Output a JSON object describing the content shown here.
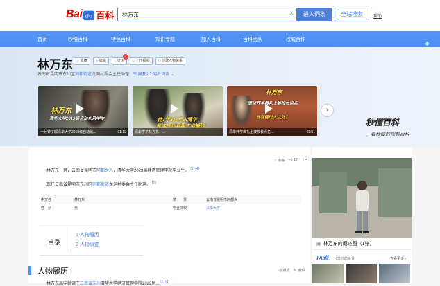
{
  "header": {
    "logo_text_a": "Bai",
    "logo_text_b": "百科",
    "search_value": "林万东",
    "enter_label": "进入词条",
    "all_search_label": "全站搜索",
    "help_label": "帮助"
  },
  "nav": {
    "items": [
      "首页",
      "秒懂百科",
      "特色百科",
      "知识专题",
      "加入百科",
      "百科团队",
      "权威合作"
    ],
    "user_label": "个人中心"
  },
  "entry": {
    "title": "林万东",
    "actions": [
      {
        "icon": "star-icon",
        "label": "收藏"
      },
      {
        "icon": "edit-icon",
        "label": "编辑"
      },
      {
        "icon": "discuss-icon",
        "label": "讨论",
        "badge": "2"
      },
      {
        "icon": "upload-video-icon",
        "label": "上传视频"
      },
      {
        "icon": "relation-icon",
        "label": "创建人物关系"
      }
    ],
    "subtitle_pre": "云南省昆明市东川区",
    "subtitle_link": "铜都街道",
    "subtitle_post": "龙洞村委会主任助理",
    "subtitle_more": "展开2个同名词条"
  },
  "videos": [
    {
      "overlay_a": "林万东",
      "overlay_b": "清华大学2019级自动化系学生",
      "caption": "一分钟了解清华大学2019级自动化...",
      "duration": "01:12"
    },
    {
      "overlay_a": "他7年3分考入清华",
      "overlay_b": "竟选择到县里工地搬砖",
      "caption": "清华学子林万东：...",
      "duration": ""
    },
    {
      "overlay_a": "林万东",
      "overlay_b": "清华开学典礼上被校长点名",
      "overlay_c": "他有何过人之处？",
      "caption": "清华开学典礼上被校长点名...",
      "duration": "03:51"
    }
  ],
  "next_arrow": "›",
  "brand": {
    "line1": "秒懂百科",
    "line2": "一看秒懂的视频百科"
  },
  "stats": [
    {
      "icon": "star-icon",
      "label": "收藏"
    },
    {
      "icon": "like-icon",
      "label": "12"
    },
    {
      "icon": "share-icon",
      "label": "4"
    }
  ],
  "intro": {
    "p1_pre": "林万东，男，云南省昆明市",
    "p1_link": "阿都乡人",
    "p1_post": "，清华大学2023届经济管理学院毕业生。",
    "p1_refs": "[1]  [4]",
    "p2_pre": "现任云南省昆明市东川区",
    "p2_link": "铜都街道",
    "p2_post": "龙洞村委会主任助理。",
    "p2_refs": "[5]"
  },
  "basic_info": {
    "rows": [
      {
        "k1": "中文名",
        "v1": "林万东",
        "k2": "籍　　贯",
        "v2": "云南省昆明市阿都乡"
      },
      {
        "k1": "性　别",
        "v1": "男",
        "k2": "毕业院校",
        "v2": "清华大学"
      }
    ]
  },
  "toc": {
    "label": "目录",
    "items": [
      "1  人物履历",
      "2  人物事迹"
    ]
  },
  "section": {
    "title": "人物履历",
    "actions": [
      "播报",
      "编辑"
    ],
    "cut_text_pre": "林万东高中就读于",
    "cut_text_link": "云南省东川",
    "cut_text_post": "清华大学经济管理学院2022届...",
    "cut_refs": "[2]  [3]"
  },
  "sidebar": {
    "photo_caption": "林万东的概述图（1张）",
    "ta_logo": "TA说",
    "ta_sub": "分享你的世界",
    "ta_more": "查看更多 ›"
  }
}
